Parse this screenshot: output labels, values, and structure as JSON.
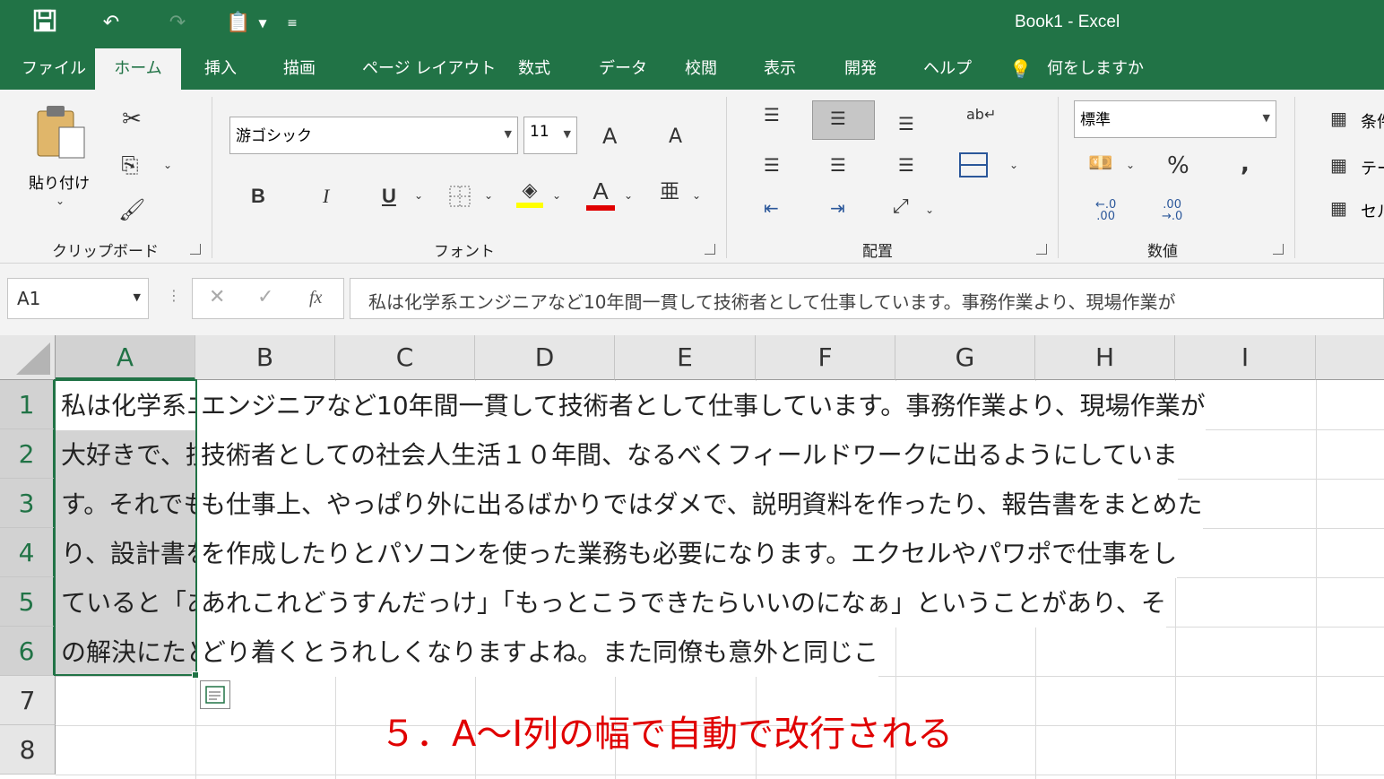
{
  "title_bar": {
    "title": "Book1  -  Excel"
  },
  "tabs": [
    {
      "label": "ファイル"
    },
    {
      "label": "ホーム"
    },
    {
      "label": "挿入"
    },
    {
      "label": "描画"
    },
    {
      "label": "ページ レイアウト"
    },
    {
      "label": "数式"
    },
    {
      "label": "データ"
    },
    {
      "label": "校閲"
    },
    {
      "label": "表示"
    },
    {
      "label": "開発"
    },
    {
      "label": "ヘルプ"
    },
    {
      "label": "何をしますか"
    }
  ],
  "ribbon": {
    "clipboard": {
      "paste_label": "貼り付け",
      "group_label": "クリップボード"
    },
    "font": {
      "font_name": "游ゴシック",
      "font_size": "11",
      "group_label": "フォント",
      "bold": "B",
      "italic": "I",
      "underline": "U",
      "grow": "A",
      "shrink": "A",
      "font_color": "A"
    },
    "alignment": {
      "group_label": "配置"
    },
    "number": {
      "format": "標準",
      "percent": "%",
      "comma": ",",
      "group_label": "数値",
      "inc_decimal": "←.0\n.00",
      "dec_decimal": ".00\n→.0"
    },
    "styles": {
      "cond_format": "条件",
      "table_format": "テー",
      "cell_styles": "セル"
    }
  },
  "formula_bar": {
    "name_box": "A1",
    "fx": "fx",
    "formula": "私は化学系エンジニアなど10年間一貫して技術者として仕事しています。事務作業より、現場作業が"
  },
  "columns": [
    "A",
    "B",
    "C",
    "D",
    "E",
    "F",
    "G",
    "H",
    "I"
  ],
  "rows": [
    "1",
    "2",
    "3",
    "4",
    "5",
    "6",
    "7",
    "8"
  ],
  "cells_a": [
    "私は化学系エンジニアなど10年間一貫して技術者として仕事しています。事務作業より、現場作業が",
    "大好きで、技術者としての社会人生活１０年間、なるべくフィールドワークに出るようにしていま",
    "す。それでも仕事上、やっぱり外に出るばかりではダメで、説明資料を作ったり、報告書をまとめた",
    "り、設計書を作成したりとパソコンを使った業務も必要になります。エクセルやパワポで仕事をし",
    "ていると「あれこれどうすんだっけ」「もっとこうできたらいいのになぁ」ということがあり、そ",
    "の解決にたどり着くとうれしくなりますよね。また同僚も意外と同じこ"
  ],
  "cells_spill": [
    "エンジニアなど10年間一貫して技術者として仕事しています。事務作業より、現場作業が",
    "技術者としての社会人生活１０年間、なるべくフィールドワークに出るようにしていま",
    "も仕事上、やっぱり外に出るばかりではダメで、説明資料を作ったり、報告書をまとめた",
    "を作成したりとパソコンを使った業務も必要になります。エクセルやパワポで仕事をし",
    "あれこれどうすんだっけ」「もっとこうできたらいいのになぁ」ということがあり、そ",
    "どり着くとうれしくなりますよね。また同僚も意外と同じこ"
  ],
  "annotation": "５．A～I列の幅で自動で改行される"
}
